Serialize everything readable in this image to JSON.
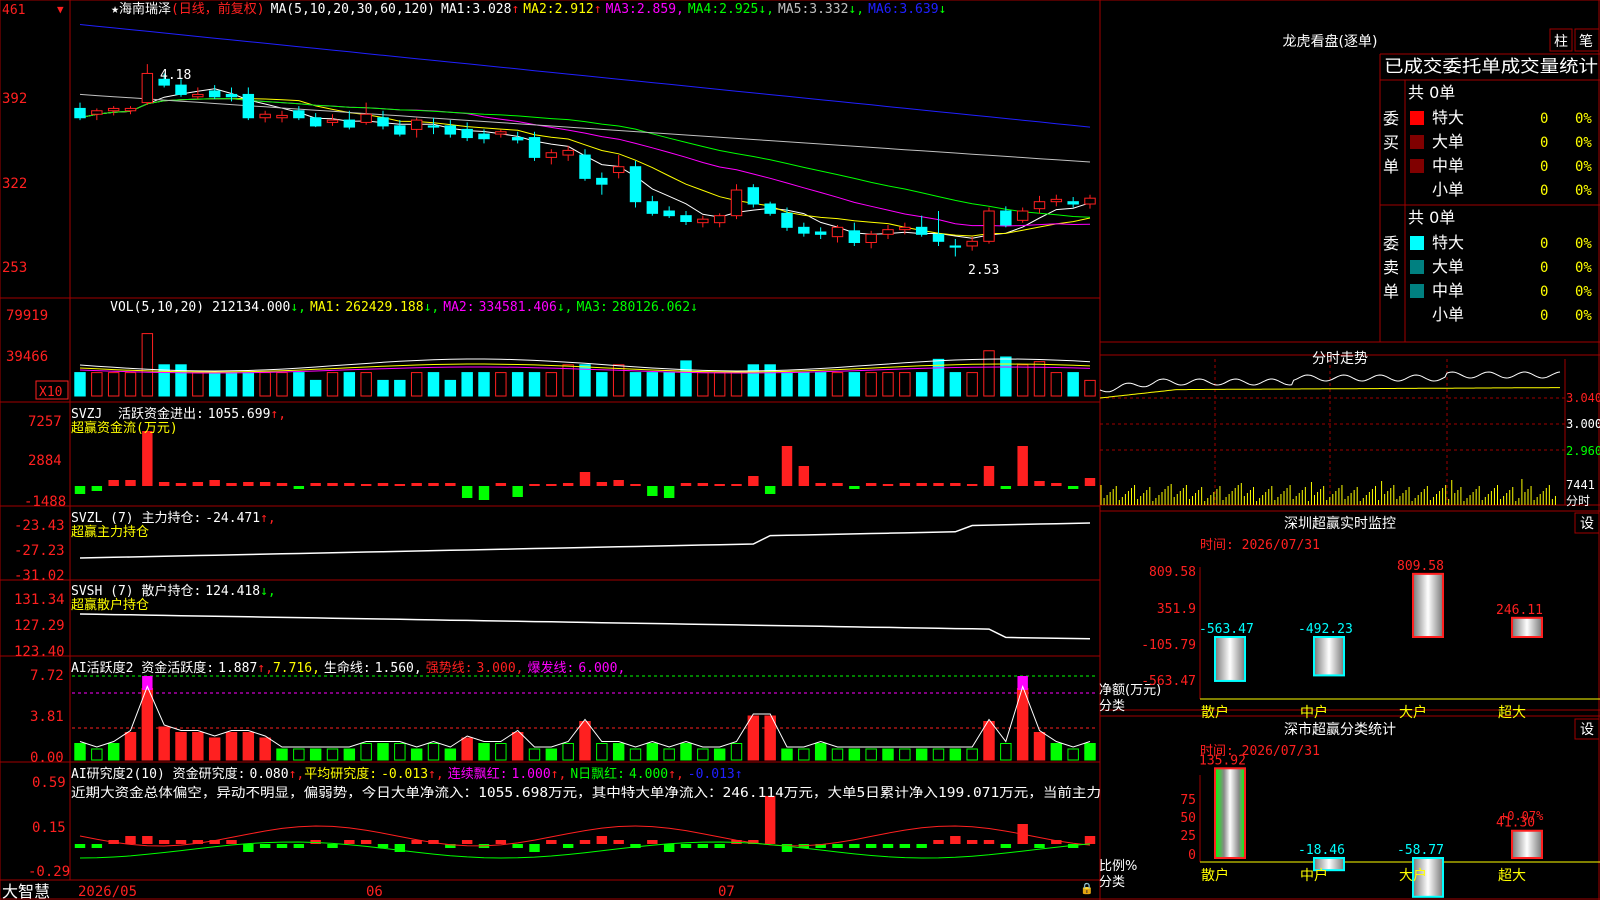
{
  "colors": {
    "up": "#ff2020",
    "down": "#00ffff",
    "frame": "#a00000",
    "ma1": "#ffffff",
    "ma2": "#ffff00",
    "ma3": "#ff00ff",
    "ma4": "#00ff00",
    "ma5": "#c0c0c0",
    "ma6": "#2020ff",
    "green": "#00ff00",
    "pink": "#ff00ff"
  },
  "price": {
    "stock_name": "海南瑞泽",
    "period": "(日线，前复权)",
    "ma_header": "MA(5,10,20,30,60,120)",
    "ma_values": [
      {
        "label": "MA1:",
        "value": "3.028",
        "arrow": "↑"
      },
      {
        "label": "MA2:",
        "value": "2.912",
        "arrow": "↑"
      },
      {
        "label": "MA3:",
        "value": "2.859",
        "arrow": ","
      },
      {
        "label": "MA4:",
        "value": "2.925",
        "arrow": "↓,"
      },
      {
        "label": "MA5:",
        "value": "3.332",
        "arrow": "↓,"
      },
      {
        "label": "MA6:",
        "value": "3.639",
        "arrow": "↓"
      }
    ],
    "y_ticks": [
      "461",
      "392",
      "322",
      "253"
    ],
    "high_marker": "4.18",
    "low_marker": "2.53"
  },
  "volume": {
    "header": "VOL(5,10,20)",
    "value": "212134.000",
    "ma_values": [
      {
        "label": "MA1:",
        "value": "262429.188",
        "arrow": "↓,"
      },
      {
        "label": "MA2:",
        "value": "334581.406",
        "arrow": "↓,"
      },
      {
        "label": "MA3:",
        "value": "280126.062",
        "arrow": "↓"
      }
    ],
    "y_ticks": [
      "79919",
      "39466"
    ],
    "unit_badge": "X10"
  },
  "svzj": {
    "header": "SVZJ  活跃资金进出:",
    "value": "1055.699",
    "arrow": "↑,",
    "subtitle": "超赢资金流(万元)",
    "y_ticks": [
      "7257",
      "2884",
      "-1488"
    ]
  },
  "svzl": {
    "header": "SVZL (7) 主力持仓:",
    "value": "-24.471",
    "arrow": "↑,",
    "subtitle": "超赢主力持仓",
    "y_ticks": [
      "-23.43",
      "-27.23",
      "-31.02"
    ]
  },
  "svsh": {
    "header": "SVSH (7) 散户持仓:",
    "value": "124.418",
    "arrow": "↓,",
    "subtitle": "超赢散户持仓",
    "y_ticks": [
      "131.34",
      "127.29",
      "123.40"
    ]
  },
  "ai_active": {
    "header": "AI活跃度2 资金活跃度:",
    "value": "1.887",
    "v2": "7.716,",
    "life_label": "生命线:",
    "life_value": "1.560,",
    "strong_label": "强势线:",
    "strong_value": "3.000,",
    "burst_label": "爆发线:",
    "burst_value": "6.000,",
    "y_ticks": [
      "7.72",
      "3.81",
      "0.00"
    ]
  },
  "ai_research": {
    "header": "AI研究度2(10) 资金研究度:",
    "value": "0.080",
    "avg_label": "平均研究度:",
    "avg_value": "-0.013",
    "red_label": "连续飘红:",
    "red_value": "1.000",
    "n_label": "N日飘红:",
    "n_value": "4.000",
    "n2_value": "-0.013",
    "comment": "近期大资金总体偏空，异动不明显，偏弱势，今日大单净流入：1055.698万元，其中特大单净流入：246.114万元，大单5日累计净入199.071万元，当前主力",
    "y_ticks": [
      "0.59",
      "0.15",
      "-0.29"
    ]
  },
  "date_axis": {
    "logo": "大智慧",
    "labels": [
      "2026/05",
      "06",
      "07"
    ]
  },
  "dragon_tiger": {
    "title": "龙虎看盘(逐单)",
    "btn_zhu": "柱",
    "btn_bi": "笔",
    "header": "已成交委托单成交量统计",
    "buy": {
      "side": "委买单",
      "total": "共 0单",
      "rows": [
        {
          "label": "特大",
          "qty": "0",
          "pct": "0%",
          "color": "#ff0000"
        },
        {
          "label": "大单",
          "qty": "0",
          "pct": "0%",
          "color": "#800000"
        },
        {
          "label": "中单",
          "qty": "0",
          "pct": "0%",
          "color": "#800000"
        },
        {
          "label": "小单",
          "qty": "0",
          "pct": "0%",
          "color": ""
        }
      ]
    },
    "sell": {
      "side": "委卖单",
      "total": "共 0单",
      "rows": [
        {
          "label": "特大",
          "qty": "0",
          "pct": "0%",
          "color": "#00ffff"
        },
        {
          "label": "大单",
          "qty": "0",
          "pct": "0%",
          "color": "#008080"
        },
        {
          "label": "中单",
          "qty": "0",
          "pct": "0%",
          "color": "#008080"
        },
        {
          "label": "小单",
          "qty": "0",
          "pct": "0%",
          "color": ""
        }
      ]
    }
  },
  "intraday": {
    "title": "分时走势",
    "y_ticks": [
      "3.040",
      "3.000",
      "2.960"
    ],
    "vol_label": "7441",
    "time_label": "分时"
  },
  "monitor": {
    "title": "深圳超赢实时监控",
    "set_btn": "设",
    "time": "时间: 2026/07/31",
    "y_ticks": [
      "809.58",
      "351.9",
      "-105.79",
      "-563.47"
    ],
    "y_title": "净额(万元)",
    "x_title": "分类",
    "categories": [
      "散户",
      "中户",
      "大户",
      "超大"
    ],
    "values": [
      -563.47,
      -492.23,
      809.58,
      246.11
    ],
    "labels": [
      "-563.47",
      "-492.23",
      "809.58",
      "246.11"
    ]
  },
  "classify": {
    "title": "深市超赢分类统计",
    "set_btn": "设",
    "time": "时间: 2026/07/31",
    "y_ticks": [
      "75",
      "50",
      "25",
      "0"
    ],
    "y_title": "比例%",
    "x_title": "分类",
    "categories": [
      "散户",
      "中户",
      "大户",
      "超大"
    ],
    "values": [
      135.92,
      -18.46,
      -58.77,
      41.3
    ],
    "labels": [
      "135.92",
      "-18.46",
      "-58.77",
      "41.30"
    ],
    "pct_label": "+0.07%"
  },
  "chart_data": {
    "type": "candlestick",
    "dates": [
      "2026/05",
      "06",
      "07"
    ],
    "ohlc": [
      [
        3.8,
        3.85,
        3.7,
        3.72
      ],
      [
        3.75,
        3.8,
        3.7,
        3.78
      ],
      [
        3.78,
        3.82,
        3.74,
        3.8
      ],
      [
        3.78,
        3.82,
        3.75,
        3.8
      ],
      [
        3.85,
        4.18,
        3.83,
        4.1
      ],
      [
        4.05,
        4.1,
        3.98,
        4.0
      ],
      [
        4.0,
        4.05,
        3.9,
        3.92
      ],
      [
        3.9,
        3.98,
        3.88,
        3.92
      ],
      [
        3.95,
        4.0,
        3.88,
        3.9
      ],
      [
        3.92,
        3.98,
        3.86,
        3.9
      ],
      [
        3.92,
        3.98,
        3.7,
        3.72
      ],
      [
        3.72,
        3.78,
        3.68,
        3.75
      ],
      [
        3.72,
        3.78,
        3.68,
        3.74
      ],
      [
        3.78,
        3.82,
        3.7,
        3.72
      ],
      [
        3.72,
        3.76,
        3.64,
        3.65
      ],
      [
        3.68,
        3.75,
        3.65,
        3.7
      ],
      [
        3.7,
        3.78,
        3.62,
        3.64
      ],
      [
        3.68,
        3.85,
        3.66,
        3.75
      ],
      [
        3.72,
        3.78,
        3.62,
        3.65
      ],
      [
        3.65,
        3.7,
        3.56,
        3.58
      ],
      [
        3.62,
        3.72,
        3.55,
        3.7
      ],
      [
        3.65,
        3.72,
        3.58,
        3.64
      ],
      [
        3.65,
        3.7,
        3.55,
        3.58
      ],
      [
        3.62,
        3.68,
        3.52,
        3.55
      ],
      [
        3.58,
        3.62,
        3.5,
        3.54
      ],
      [
        3.58,
        3.62,
        3.55,
        3.6
      ],
      [
        3.55,
        3.6,
        3.5,
        3.53
      ],
      [
        3.55,
        3.6,
        3.35,
        3.38
      ],
      [
        3.38,
        3.45,
        3.32,
        3.42
      ],
      [
        3.4,
        3.48,
        3.35,
        3.44
      ],
      [
        3.4,
        3.45,
        3.18,
        3.2
      ],
      [
        3.2,
        3.25,
        3.06,
        3.15
      ],
      [
        3.25,
        3.4,
        3.2,
        3.3
      ],
      [
        3.3,
        3.35,
        2.95,
        3.0
      ],
      [
        3.0,
        3.05,
        2.88,
        2.9
      ],
      [
        2.92,
        2.96,
        2.86,
        2.88
      ],
      [
        2.88,
        2.92,
        2.8,
        2.83
      ],
      [
        2.82,
        2.88,
        2.78,
        2.85
      ],
      [
        2.82,
        2.9,
        2.78,
        2.88
      ],
      [
        2.88,
        3.15,
        2.85,
        3.1
      ],
      [
        3.12,
        3.15,
        2.95,
        2.98
      ],
      [
        2.98,
        3.0,
        2.88,
        2.9
      ],
      [
        2.9,
        2.95,
        2.75,
        2.78
      ],
      [
        2.78,
        2.82,
        2.7,
        2.73
      ],
      [
        2.74,
        2.78,
        2.68,
        2.72
      ],
      [
        2.7,
        2.8,
        2.65,
        2.78
      ],
      [
        2.75,
        2.82,
        2.62,
        2.65
      ],
      [
        2.65,
        2.75,
        2.6,
        2.72
      ],
      [
        2.72,
        2.8,
        2.68,
        2.76
      ],
      [
        2.76,
        2.82,
        2.72,
        2.78
      ],
      [
        2.78,
        2.88,
        2.7,
        2.72
      ],
      [
        2.72,
        2.92,
        2.62,
        2.66
      ],
      [
        2.62,
        2.68,
        2.53,
        2.61
      ],
      [
        2.62,
        2.7,
        2.58,
        2.66
      ],
      [
        2.66,
        2.95,
        2.64,
        2.92
      ],
      [
        2.92,
        2.96,
        2.78,
        2.8
      ],
      [
        2.84,
        2.95,
        2.82,
        2.92
      ],
      [
        2.94,
        3.05,
        2.9,
        3.0
      ],
      [
        3.0,
        3.06,
        2.96,
        3.02
      ],
      [
        3.0,
        3.04,
        2.95,
        2.98
      ],
      [
        2.98,
        3.06,
        2.94,
        3.03
      ]
    ],
    "ma_series": [
      {
        "name": "MA1"
      },
      {
        "name": "MA2"
      },
      {
        "name": "MA3"
      },
      {
        "name": "MA4"
      },
      {
        "name": "MA5"
      },
      {
        "name": "MA6"
      }
    ],
    "ylim": [
      2.43,
      4.61
    ]
  }
}
